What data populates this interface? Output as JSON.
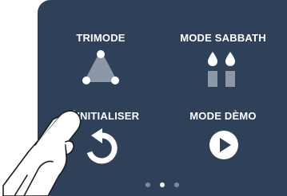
{
  "tiles": [
    {
      "label": "TRIMODE",
      "icon": "trimode-icon"
    },
    {
      "label": "MODE SABBATH",
      "icon": "sabbath-candles-icon"
    },
    {
      "label": "RÉINITIALISER",
      "icon": "reset-icon"
    },
    {
      "label": "MODE DÈMO",
      "icon": "play-icon"
    }
  ],
  "pager": {
    "count": 3,
    "active_index": 1
  },
  "colors": {
    "screen_bg": "#2f4059",
    "icon_white": "#ffffff",
    "icon_grey": "#8c97a7"
  }
}
